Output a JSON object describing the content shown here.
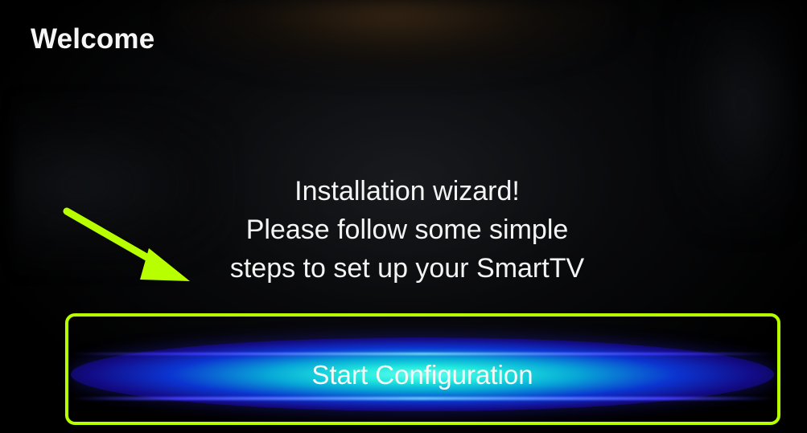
{
  "screen": {
    "title": "Welcome"
  },
  "main": {
    "message_lines": [
      "Installation wizard!",
      "Please follow some simple",
      "steps to set up your SmartTV"
    ],
    "start_button": {
      "label": "Start Configuration"
    }
  },
  "annotations": {
    "arrow": {
      "icon": "arrow-down-right-icon",
      "color": "#b8ff00"
    },
    "highlight_box": {
      "color": "#b8ff00"
    }
  },
  "colors": {
    "background": "#000000",
    "text": "#f4f4f4",
    "button_center": "#20e8dd",
    "button_edge": "#180eaa"
  }
}
